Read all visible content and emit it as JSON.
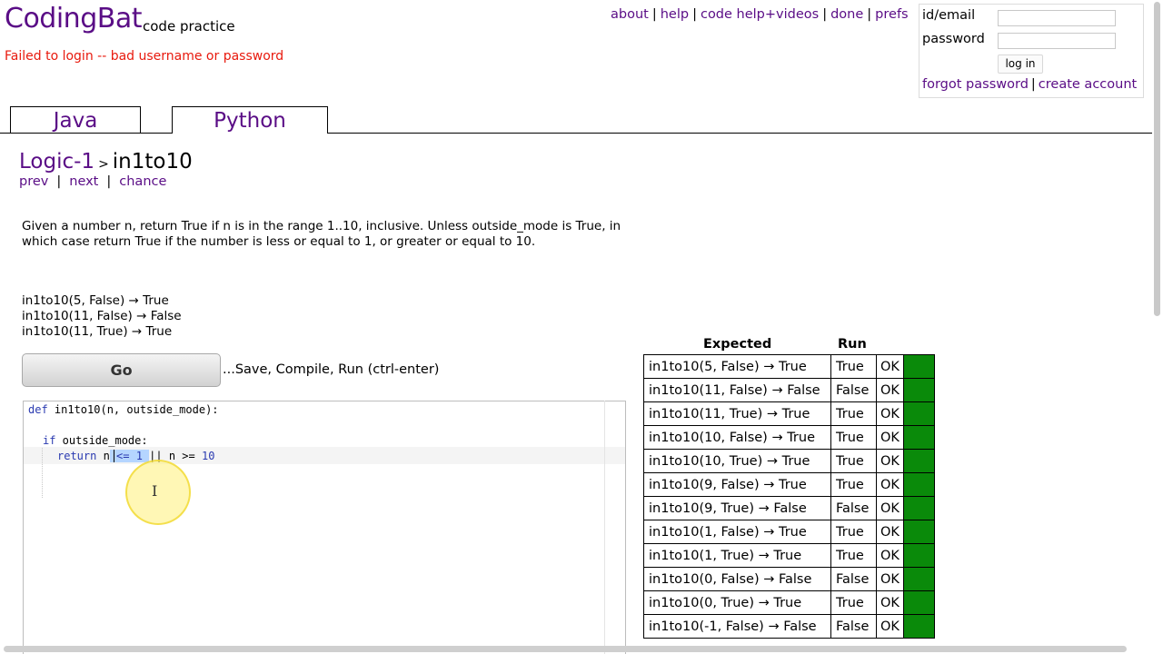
{
  "header": {
    "logo": "CodingBat",
    "tagline": "code practice",
    "login_error": "Failed to login -- bad username or password",
    "nav": [
      "about",
      "help",
      "code help+videos",
      "done",
      "prefs"
    ]
  },
  "login": {
    "id_label": "id/email",
    "password_label": "password",
    "button": "log in",
    "forgot": "forgot password",
    "create": "create account"
  },
  "tabs": {
    "java": "Java",
    "python": "Python"
  },
  "problem": {
    "category": "Logic-1",
    "separator": ">",
    "name": "in1to10",
    "nav": {
      "prev": "prev",
      "next": "next",
      "chance": "chance"
    },
    "description": "Given a number n, return True if n is in the range 1..10, inclusive. Unless outside_mode is True, in which case return True if the number is less or equal to 1, or greater or equal to 10.",
    "examples": [
      "in1to10(5, False) → True",
      "in1to10(11, False) → False",
      "in1to10(11, True) → True"
    ]
  },
  "go": {
    "label": "Go",
    "hint": "...Save, Compile, Run (ctrl-enter)"
  },
  "code": {
    "line1_kw": "def",
    "line1_rest": " in1to10(n, outside_mode):",
    "line3_kw": "if",
    "line3_rest": " outside_mode:",
    "line4_kw": "return",
    "line4_var": " n",
    "line4_selected": " <= 1 ",
    "line4_rest": "|| n >= ",
    "line4_num": "10"
  },
  "results": {
    "headers": {
      "expected": "Expected",
      "run": "Run"
    },
    "pass_color": "#0a8a0a",
    "rows": [
      {
        "expected": "in1to10(5, False) → True",
        "run": "True",
        "status": "OK"
      },
      {
        "expected": "in1to10(11, False) → False",
        "run": "False",
        "status": "OK"
      },
      {
        "expected": "in1to10(11, True) → True",
        "run": "True",
        "status": "OK"
      },
      {
        "expected": "in1to10(10, False) → True",
        "run": "True",
        "status": "OK"
      },
      {
        "expected": "in1to10(10, True) → True",
        "run": "True",
        "status": "OK"
      },
      {
        "expected": "in1to10(9, False) → True",
        "run": "True",
        "status": "OK"
      },
      {
        "expected": "in1to10(9, True) → False",
        "run": "False",
        "status": "OK"
      },
      {
        "expected": "in1to10(1, False) → True",
        "run": "True",
        "status": "OK"
      },
      {
        "expected": "in1to10(1, True) → True",
        "run": "True",
        "status": "OK"
      },
      {
        "expected": "in1to10(0, False) → False",
        "run": "False",
        "status": "OK"
      },
      {
        "expected": "in1to10(0, True) → True",
        "run": "True",
        "status": "OK"
      },
      {
        "expected": "in1to10(-1, False) → False",
        "run": "False",
        "status": "OK"
      }
    ]
  }
}
